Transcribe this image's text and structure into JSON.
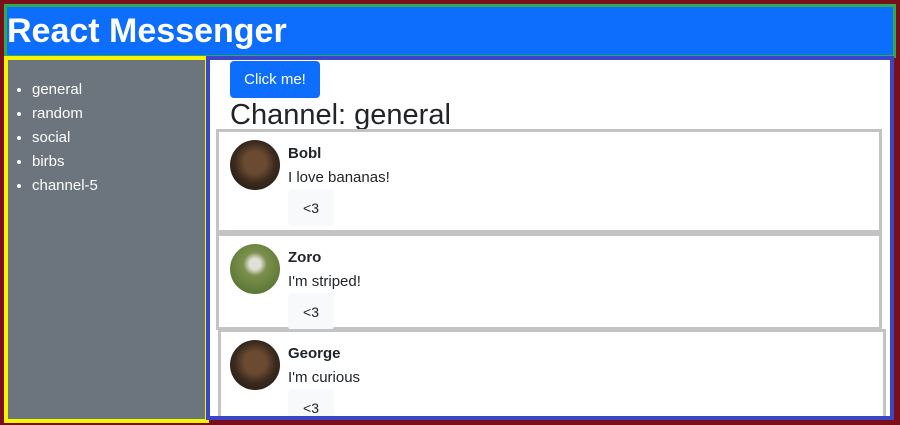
{
  "header": {
    "title": "React Messenger"
  },
  "sidebar": {
    "channels": [
      "general",
      "random",
      "social",
      "birbs",
      "channel-5"
    ]
  },
  "main": {
    "button_label": "Click me!",
    "channel_prefix": "Channel:",
    "channel_name": "general",
    "messages": [
      {
        "author": "Bobl",
        "text": "I love bananas!",
        "reaction": "<3",
        "avatar": "monkey-avatar"
      },
      {
        "author": "Zoro",
        "text": "I'm striped!",
        "reaction": "<3",
        "avatar": "zebra-avatar"
      },
      {
        "author": "George",
        "text": "I'm curious",
        "reaction": "<3",
        "avatar": "monkey-avatar"
      }
    ]
  },
  "colors": {
    "header_bg": "#0d6efd",
    "sidebar_bg": "#6c757d",
    "page_bg": "#7a0f19",
    "header_border": "#2eab52",
    "sidebar_border": "#f5f500",
    "main_border": "#3a45c8"
  }
}
